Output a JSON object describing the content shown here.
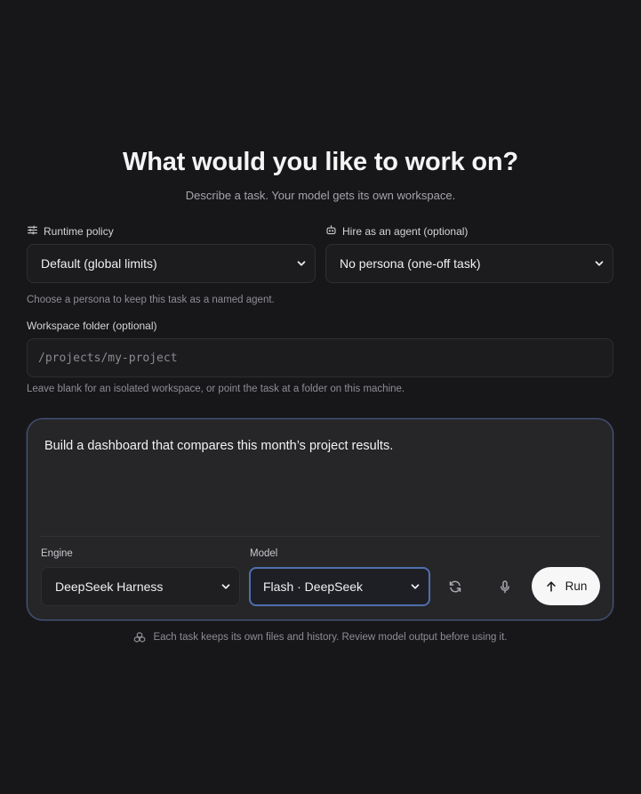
{
  "hero": {
    "title": "What would you like to work on?",
    "subtitle": "Describe a task. Your model gets its own workspace."
  },
  "runtime_policy": {
    "label": "Runtime policy",
    "selected": "Default (global limits)",
    "icon": "sliders-icon"
  },
  "agent": {
    "label": "Hire as an agent (optional)",
    "selected": "No persona (one-off task)",
    "help": "Choose a persona to keep this task as a named agent.",
    "icon": "robot-icon"
  },
  "workspace": {
    "label": "Workspace folder (optional)",
    "placeholder": "/projects/my-project",
    "value": "",
    "help": "Leave blank for an isolated workspace, or point the task at a folder on this machine."
  },
  "composer": {
    "prompt": "Build a dashboard that compares this month’s project results.",
    "engine_label": "Engine",
    "engine_selected": "DeepSeek Harness",
    "model_label": "Model",
    "model_selected": "Flash · DeepSeek",
    "run_label": "Run"
  },
  "footer": {
    "text": "Each task keeps its own files and history. Review model output before using it.",
    "icon": "cubes-icon"
  },
  "colors": {
    "background": "#17171a",
    "composer_border": "#4a5a80",
    "focus_ring": "#4d6fae",
    "run_button": "#f7f7f8"
  }
}
